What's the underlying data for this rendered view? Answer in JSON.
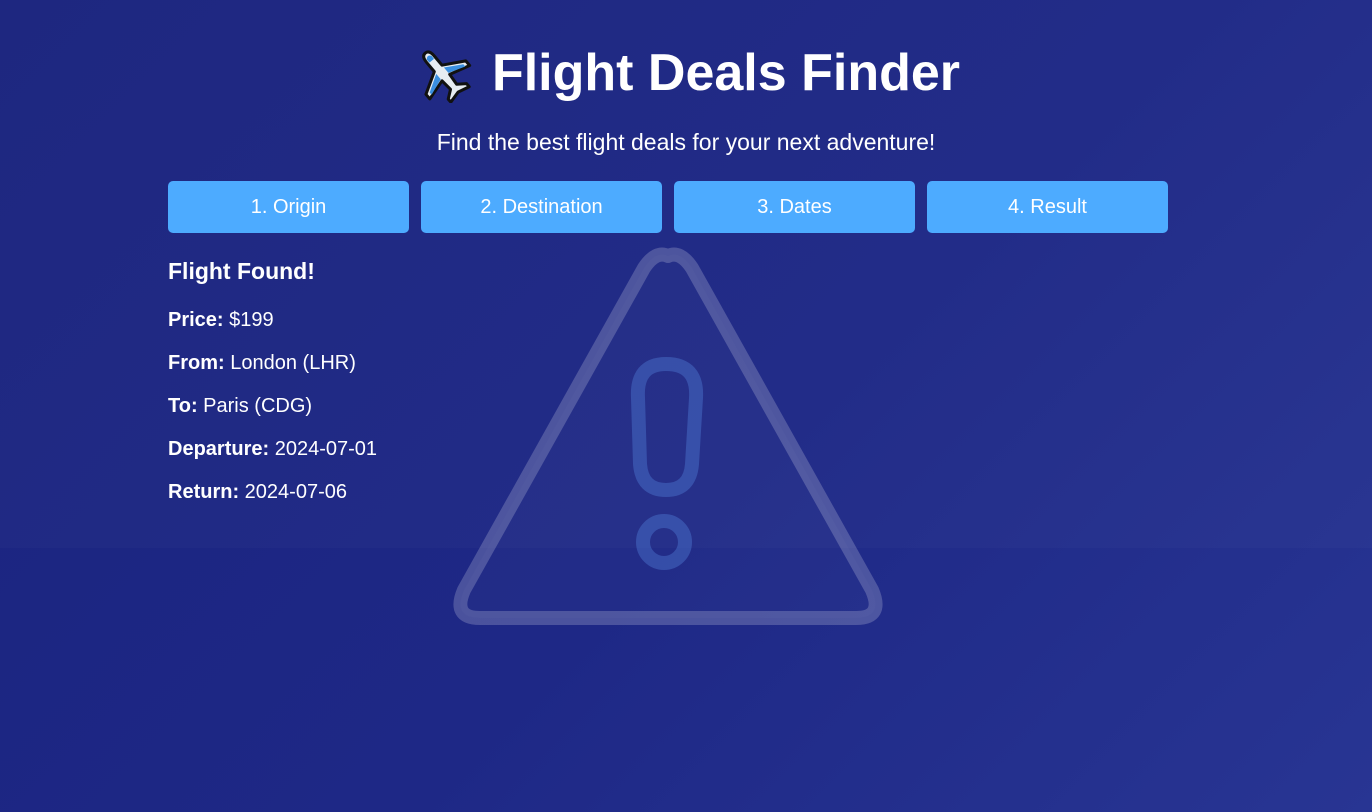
{
  "header": {
    "icon": "airplane-icon",
    "title": "Flight Deals Finder",
    "subtitle": "Find the best flight deals for your next adventure!"
  },
  "steps": [
    {
      "label": "1. Origin"
    },
    {
      "label": "2. Destination"
    },
    {
      "label": "3. Dates"
    },
    {
      "label": "4. Result"
    }
  ],
  "result": {
    "title": "Flight Found!",
    "price_label": "Price:",
    "price_value": "$199",
    "from_label": "From:",
    "from_value": "London (LHR)",
    "to_label": "To:",
    "to_value": "Paris (CDG)",
    "departure_label": "Departure:",
    "departure_value": "2024-07-01",
    "return_label": "Return:",
    "return_value": "2024-07-06"
  },
  "watermark": {
    "icon": "warning-triangle-icon"
  },
  "colors": {
    "background": "#1a237e",
    "accent": "#4dabff",
    "text": "#ffffff"
  }
}
